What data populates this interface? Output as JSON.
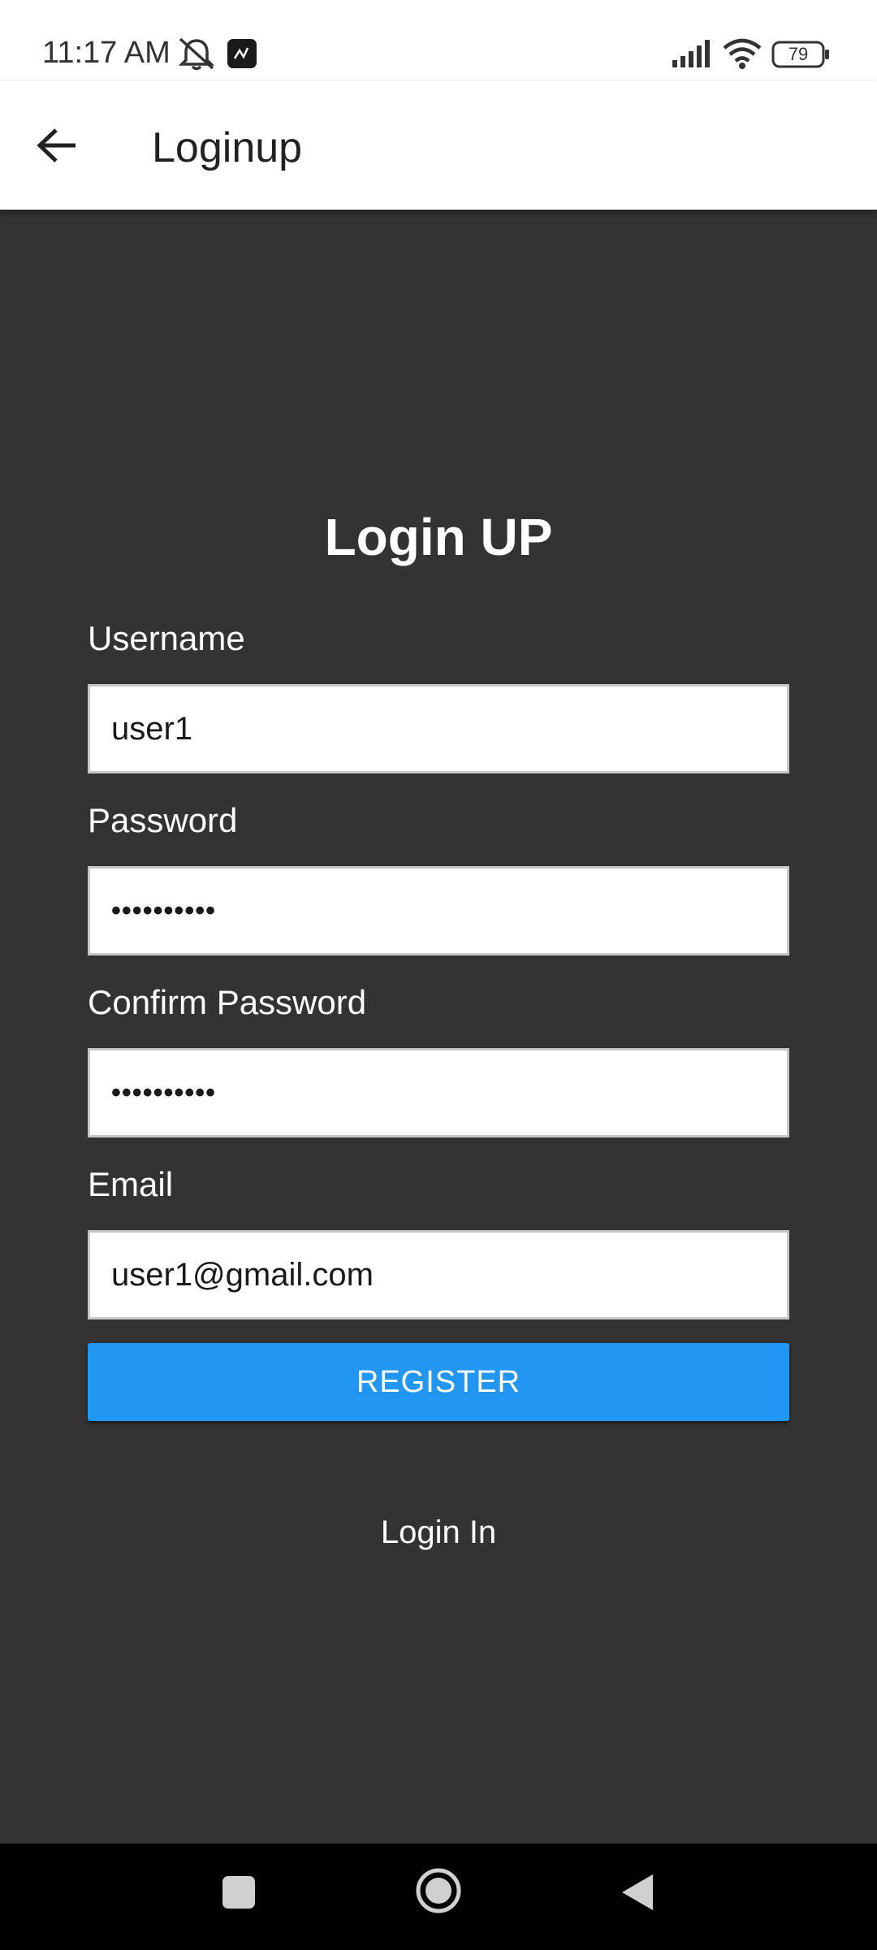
{
  "status_bar": {
    "time": "11:17 AM",
    "battery": "79",
    "icons": [
      "mute-icon",
      "app-notification-icon",
      "signal-icon",
      "wifi-icon",
      "battery-icon"
    ]
  },
  "app_bar": {
    "title": "Loginup",
    "back_icon": "arrow-back-icon"
  },
  "form": {
    "title": "Login UP",
    "username_label": "Username",
    "username_value": "user1",
    "password_label": "Password",
    "password_value": "••••••••••",
    "confirm_password_label": "Confirm Password",
    "confirm_password_value": "••••••••••",
    "email_label": "Email",
    "email_value": "user1@gmail.com",
    "register_label": "REGISTER",
    "login_link": "Login In"
  },
  "nav_bar": {
    "icons": [
      "recents-icon",
      "home-icon",
      "back-icon"
    ]
  },
  "colors": {
    "background": "#333333",
    "accent": "#2196f3",
    "app_bar": "#ffffff"
  }
}
